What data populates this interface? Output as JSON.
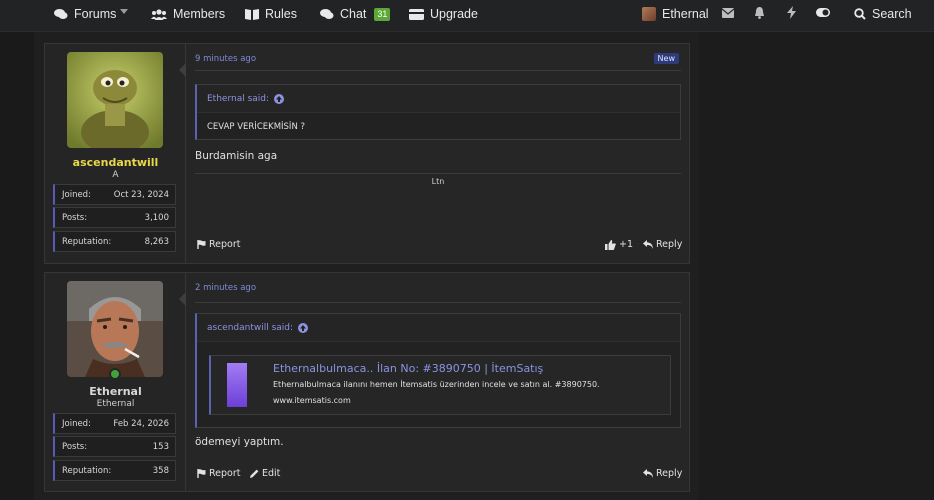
{
  "nav": {
    "forums": "Forums",
    "members": "Members",
    "rules": "Rules",
    "chat": "Chat",
    "chat_count": "31",
    "upgrade": "Upgrade",
    "user": "Ethernal",
    "search": "Search"
  },
  "posts": [
    {
      "time": "9 minutes ago",
      "badge": "New",
      "username": "ascendantwill",
      "username_color": "#e8d84a",
      "user_title": "A",
      "stats": [
        {
          "label": "Joined:",
          "value": "Oct 23, 2024"
        },
        {
          "label": "Posts:",
          "value": "3,100"
        },
        {
          "label": "Reputation:",
          "value": "8,263"
        }
      ],
      "quote_author": "Ethernal said:",
      "quote_text": "CEVAP VERİCEKMİSİN ?",
      "message": "Burdamisin aga",
      "signature": "Ltn",
      "report": "Report",
      "like_count": "+1",
      "reply": "Reply"
    },
    {
      "time": "2 minutes ago",
      "username": "Ethernal",
      "username_color": "#d8d8d8",
      "user_title": "Ethernal",
      "stats": [
        {
          "label": "Joined:",
          "value": "Feb 24, 2026"
        },
        {
          "label": "Posts:",
          "value": "153"
        },
        {
          "label": "Reputation:",
          "value": "358"
        }
      ],
      "quote_author": "ascendantwill said:",
      "embed": {
        "title": "Ethernalbulmaca.. İlan No: #3890750 | İtemSatış",
        "description": "Ethernalbulmaca ilanını hemen İtemsatis üzerinden incele ve satın al. #3890750.",
        "url": "www.itemsatis.com"
      },
      "message": "ödemeyi yaptım.",
      "report": "Report",
      "edit": "Edit",
      "reply": "Reply"
    }
  ]
}
